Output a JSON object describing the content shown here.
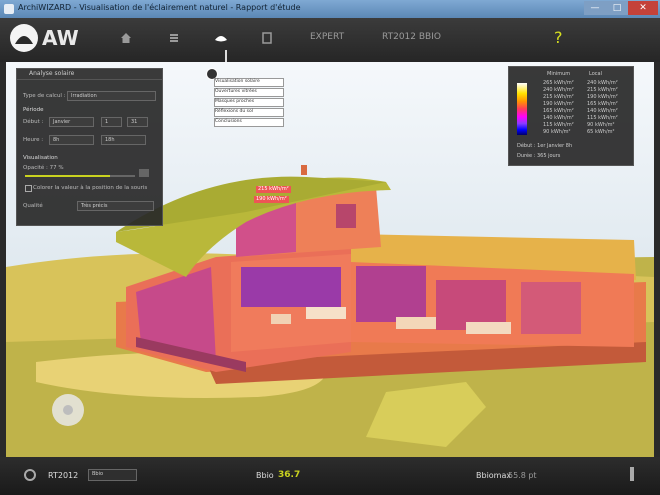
{
  "window": {
    "title": "ArchiWIZARD - Visualisation de l'éclairement naturel - Rapport d'étude"
  },
  "topbar": {
    "logo_text": "AW",
    "nav": [
      {
        "icon": "home-icon",
        "label": ""
      },
      {
        "icon": "layers-icon",
        "label": ""
      },
      {
        "icon": "visualization-icon",
        "label": ""
      },
      {
        "icon": "document-icon",
        "label": ""
      },
      {
        "icon": "",
        "label": "EXPERT"
      },
      {
        "icon": "",
        "label": "RT2012 BBIO"
      }
    ],
    "help_label": "?"
  },
  "left_panel": {
    "title": "Analyse solaire",
    "type_label": "Type de calcul :",
    "type_value": "Irradiation",
    "period_title": "Période",
    "from_label": "Début :",
    "from_month": "Janvier",
    "from_day": "1",
    "to_day": "31",
    "hours_label": "Heure :",
    "hour_start": "8h",
    "hour_end": "18h",
    "display_title": "Visualisation",
    "opacity_label": "Opacité : 77 %",
    "checkbox_label": "Colorer la valeur à la position de la souris",
    "quality_label": "Qualité",
    "quality_value": "Très précis"
  },
  "legend": {
    "header_left": "Minimum",
    "header_right": "Local",
    "colors": [
      "#ffffff",
      "#ffe300",
      "#ff9600",
      "#ff3a5a",
      "#ff00ff",
      "#8a3cff",
      "#0000ff",
      "#000066"
    ],
    "rows": [
      {
        "left": "265 kWh/m²",
        "right": "240 kWh/m²"
      },
      {
        "left": "240 kWh/m²",
        "right": "215 kWh/m²"
      },
      {
        "left": "215 kWh/m²",
        "right": "190 kWh/m²"
      },
      {
        "left": "190 kWh/m²",
        "right": "165 kWh/m²"
      },
      {
        "left": "165 kWh/m²",
        "right": "140 kWh/m²"
      },
      {
        "left": "140 kWh/m²",
        "right": "115 kWh/m²"
      },
      {
        "left": "115 kWh/m²",
        "right": "90 kWh/m²"
      },
      {
        "left": "90 kWh/m²",
        "right": "65 kWh/m²"
      }
    ],
    "footer1": "Début : 1er Janvier 8h",
    "footer2": "Durée : 365 jours"
  },
  "callouts": [
    "Visualisation solaire",
    "Ouvertures vitrées",
    "Masques proches",
    "Réflexions du sol",
    "Conclusions"
  ],
  "tags": [
    "215 kWh/m²",
    "190 kWh/m²"
  ],
  "bottombar": {
    "rt_label": "RT2012",
    "mode_label": "Bbio",
    "bbio_label": "Bbio",
    "bbio_value": "36.7",
    "bbiomax_label": "Bbiomax",
    "bbiomax_value": "55.8 pt"
  }
}
